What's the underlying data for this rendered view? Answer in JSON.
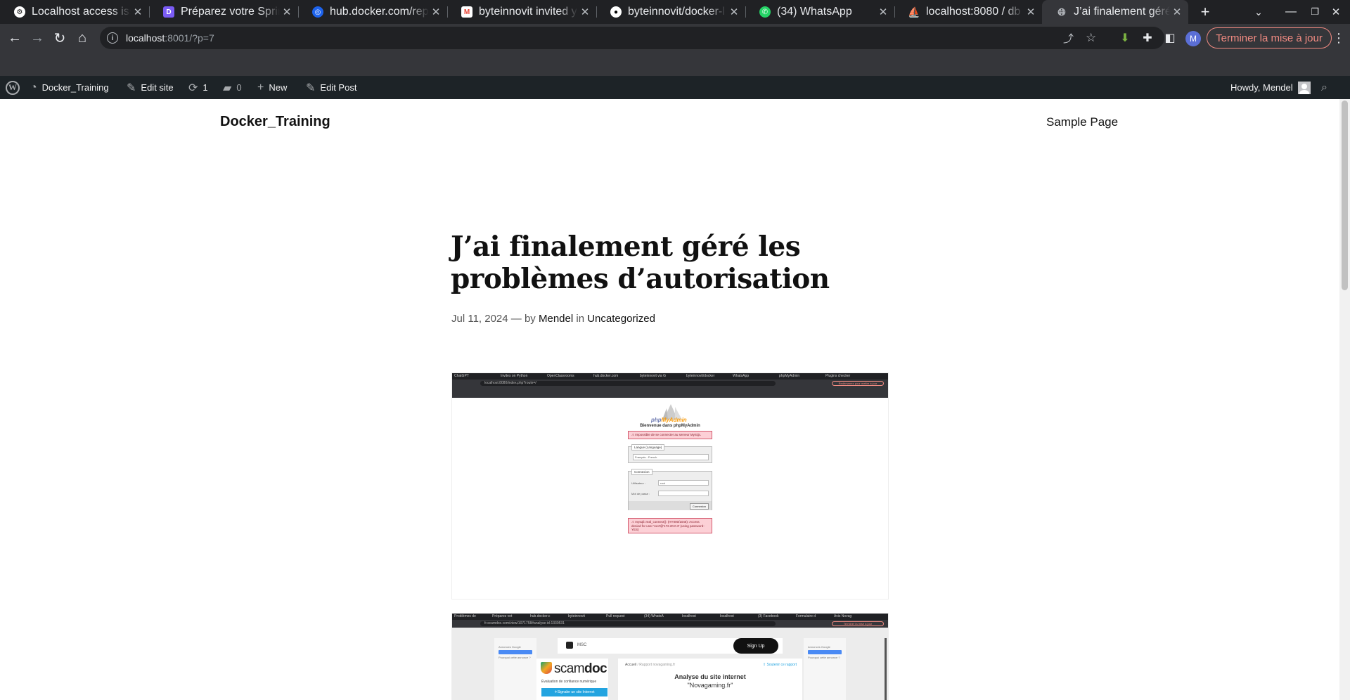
{
  "browser": {
    "tabs": [
      {
        "title": "Localhost access issu",
        "favicon": "openai-icon"
      },
      {
        "title": "Préparez votre Sprint",
        "favicon": "app-icon"
      },
      {
        "title": "hub.docker.com/rep",
        "favicon": "docker-icon"
      },
      {
        "title": "byteinnovit invited y",
        "favicon": "gmail-icon"
      },
      {
        "title": "byteinnovit/docker-l",
        "favicon": "github-icon"
      },
      {
        "title": "(34) WhatsApp",
        "favicon": "whatsapp-icon"
      },
      {
        "title": "localhost:8080 / db /",
        "favicon": "phpmyadmin-icon"
      },
      {
        "title": "J’ai finalement géré",
        "favicon": "globe-icon"
      }
    ],
    "url_host": "localhost",
    "url_rest": ":8001/?p=7",
    "profile_initial": "M",
    "update_button": "Terminer la mise à jour",
    "accent_update": "#f28b82"
  },
  "adminbar": {
    "site_name": "Docker_Training",
    "edit_site": "Edit site",
    "updates_count": "1",
    "comments_count": "0",
    "new_label": "New",
    "edit_post": "Edit Post",
    "howdy": "Howdy, Mendel"
  },
  "site": {
    "title": "Docker_Training",
    "nav": [
      "Sample Page"
    ]
  },
  "post": {
    "title": "J’ai finalement géré les problèmes d’autorisation",
    "date": "Jul 11, 2024",
    "sep": "—",
    "by": "by",
    "author": "Mendel",
    "in": "in",
    "category": "Uncategorized"
  },
  "image1": {
    "tabs": [
      "ChatGPT",
      "Invites on Python",
      "OpenClassrooms",
      "hub.docker.com",
      "byteinnovit via G",
      "byteinnovit/docker",
      "WhatsApp",
      "phpMyAdmin",
      "Plugins checker"
    ],
    "url": "localhost:8080/index.php?route=/",
    "update_button": "Redémarrez pour mettre à jour",
    "brand_php": "php",
    "brand_myadmin": "MyAdmin",
    "welcome": "Bienvenue dans phpMyAdmin",
    "error1": "Impossible de se connecter au serveur MySQL",
    "language_legend": "Langue (Language)",
    "language_value": "Français - French",
    "login_legend": "Connexion",
    "user_label": "Utilisateur :",
    "user_value": "root",
    "password_label": "Mot de passe :",
    "submit": "Connexion",
    "error2": "mysqli::real_connect(): (HY000/1045): Access denied for user 'root'@'172.20.0.3' (using password: YES)"
  },
  "image2": {
    "tabs": [
      "Problèmes de",
      "Préparez vot",
      "hub.docker.c",
      "byteinnovit",
      "Pull request",
      "(34) WhatsA",
      "localhost",
      "localhost",
      "(3) Facebook",
      "Formulaire d",
      "Avis Novag"
    ],
    "url": "fr.scamdoc.com/view/1071758#analyse-id-1330531",
    "update_button": "Terminer la mise à jour",
    "msc": "MSC",
    "signup": "Sign Up",
    "ads_label": "Annonces Google",
    "ads_button": "Envoyer un commentaire",
    "ads_link": "Pourquoi cette annonce ?",
    "brand_scam": "scam",
    "brand_doc": "doc",
    "tagline": "Évaluation de confiance numérique",
    "report_button": "Signaler un site Internet",
    "crumb_home": "Accueil",
    "crumb_sep": "/",
    "crumb_report": "Rapport novagaming.fr",
    "support": "Soutenir ce rapport",
    "analyse_title": "Analyse du site internet",
    "analyse_site": "\"Novagaming.fr\""
  }
}
